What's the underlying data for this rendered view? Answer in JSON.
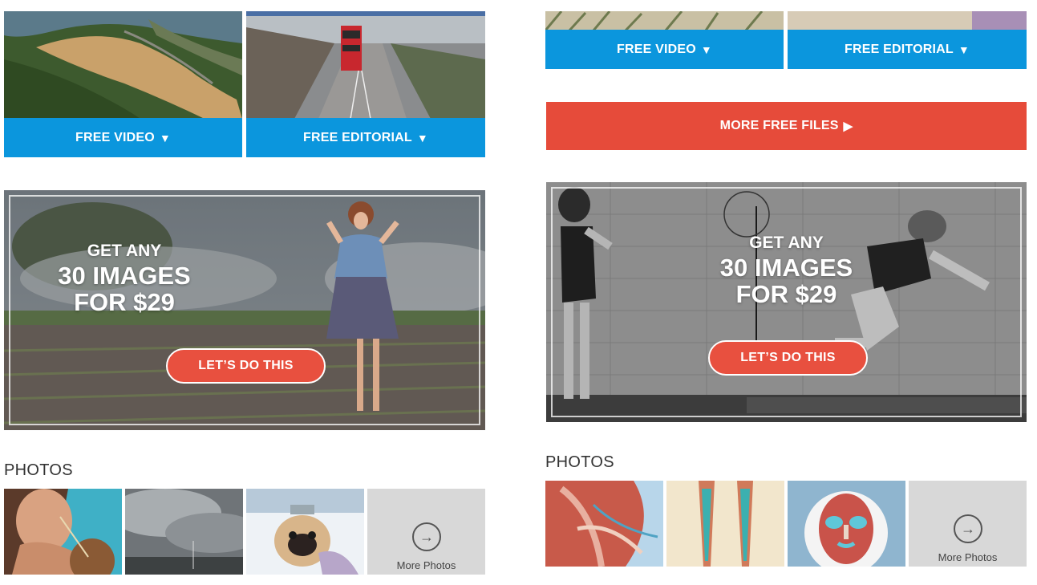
{
  "left": {
    "free_video_label": "FREE VIDEO",
    "free_editorial_label": "FREE EDITORIAL",
    "arrow_icon": "triangle-down-icon",
    "promo": {
      "line1": "GET ANY",
      "line2": "30 IMAGES",
      "line3": "FOR $29",
      "cta": "LET’S DO THIS"
    },
    "photos_title": "PHOTOS",
    "more_photos_label": "More Photos"
  },
  "right": {
    "free_video_label": "FREE VIDEO",
    "free_editorial_label": "FREE EDITORIAL",
    "more_free_files_label": "MORE FREE FILES",
    "promo": {
      "line1": "GET ANY",
      "line2": "30 IMAGES",
      "line3": "FOR $29",
      "cta": "LET’S DO THIS"
    },
    "photos_title": "PHOTOS",
    "more_photos_label": "More Photos"
  },
  "colors": {
    "free_button_blue": "#0b96dd",
    "more_files_red": "#e64b3a",
    "cta_red": "#e8503f",
    "more_tile_gray": "#d8d8d8"
  }
}
